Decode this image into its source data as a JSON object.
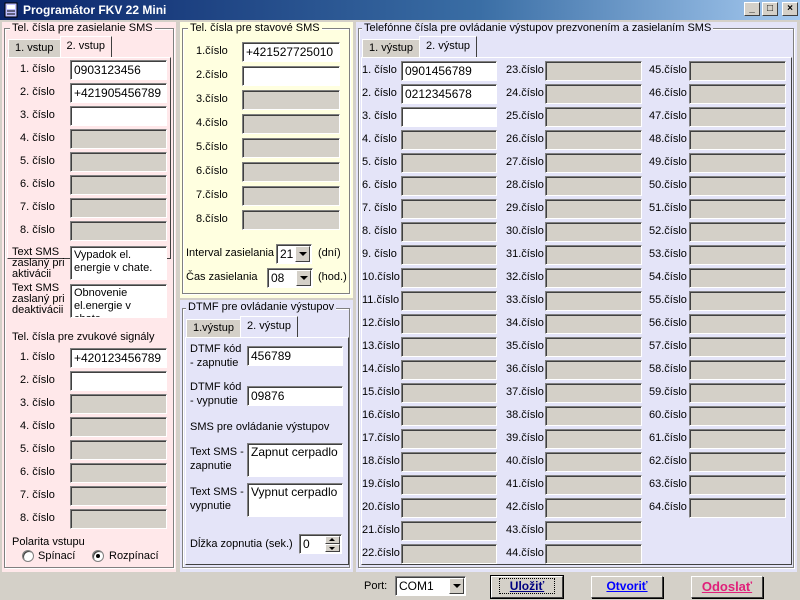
{
  "window": {
    "title": "Programátor FKV 22 Mini"
  },
  "sms_panel": {
    "title": "Tel. čísla pre zasielanie SMS",
    "tabs": [
      "1. vstup",
      "2. vstup"
    ],
    "active_tab": 1,
    "numbers": [
      {
        "label": "1. číslo",
        "value": "0903123456",
        "enabled": true
      },
      {
        "label": "2. číslo",
        "value": "+421905456789",
        "enabled": true
      },
      {
        "label": "3. číslo",
        "value": "",
        "enabled": true
      },
      {
        "label": "4. číslo",
        "value": "",
        "enabled": false
      },
      {
        "label": "5. číslo",
        "value": "",
        "enabled": false
      },
      {
        "label": "6. číslo",
        "value": "",
        "enabled": false
      },
      {
        "label": "7. číslo",
        "value": "",
        "enabled": false
      },
      {
        "label": "8. číslo",
        "value": "",
        "enabled": false
      }
    ],
    "activation": {
      "label": "Text SMS zaslaný pri aktivácii",
      "value": "Vypadok el. energie v chate."
    },
    "deactivation": {
      "label": "Text SMS zaslaný pri deaktivácii",
      "value": "Obnovenie el.energie v chate."
    },
    "sound_title": "Tel. čísla pre zvukové signály",
    "sound_numbers": [
      {
        "label": "1. číslo",
        "value": "+420123456789",
        "enabled": true
      },
      {
        "label": "2. číslo",
        "value": "",
        "enabled": true
      },
      {
        "label": "3. číslo",
        "value": "",
        "enabled": false
      },
      {
        "label": "4. číslo",
        "value": "",
        "enabled": false
      },
      {
        "label": "5. číslo",
        "value": "",
        "enabled": false
      },
      {
        "label": "6. číslo",
        "value": "",
        "enabled": false
      },
      {
        "label": "7. číslo",
        "value": "",
        "enabled": false
      },
      {
        "label": "8. číslo",
        "value": "",
        "enabled": false
      }
    ],
    "polarity_label": "Polarita vstupu",
    "polarity_options": [
      "Spínací",
      "Rozpínací"
    ],
    "polarity_selected": 1
  },
  "status_panel": {
    "title": "Tel. čísla pre stavové SMS",
    "numbers": [
      {
        "label": "1.číslo",
        "value": "+421527725010",
        "enabled": true
      },
      {
        "label": "2.číslo",
        "value": "",
        "enabled": true
      },
      {
        "label": "3.číslo",
        "value": "",
        "enabled": false
      },
      {
        "label": "4.číslo",
        "value": "",
        "enabled": false
      },
      {
        "label": "5.číslo",
        "value": "",
        "enabled": false
      },
      {
        "label": "6.číslo",
        "value": "",
        "enabled": false
      },
      {
        "label": "7.číslo",
        "value": "",
        "enabled": false
      },
      {
        "label": "8.číslo",
        "value": "",
        "enabled": false
      }
    ],
    "interval_label": "Interval zasielania",
    "interval_value": "21",
    "interval_unit": "(dní)",
    "time_label": "Čas zasielania",
    "time_value": "08",
    "time_unit": "(hod.)"
  },
  "dtmf_panel": {
    "title": "DTMF pre ovládanie výstupov",
    "tabs": [
      "1.výstup",
      "2. výstup"
    ],
    "active_tab": 1,
    "code_on_label": "DTMF kód - zapnutie",
    "code_on_value": "456789",
    "code_off_label": "DTMF kód - vypnutie",
    "code_off_value": "09876",
    "sms_title": "SMS pre ovládanie výstupov",
    "sms_on_label": "Text SMS - zapnutie",
    "sms_on_value": "Zapnut cerpadlo",
    "sms_off_label": "Text SMS - vypnutie",
    "sms_off_value": "Vypnut cerpadlo",
    "duration_label": "Dĺžka zopnutia (sek.)",
    "duration_value": "0"
  },
  "output_panel": {
    "title": "Telefónne čísla pre ovládanie výstupov prezvonením a zasielaním SMS",
    "tabs": [
      "1. výstup",
      "2. výstup"
    ],
    "active_tab": 1,
    "col1": [
      {
        "label": "1. číslo",
        "value": "0901456789",
        "enabled": true
      },
      {
        "label": "2. číslo",
        "value": "0212345678",
        "enabled": true
      },
      {
        "label": "3. číslo",
        "value": "",
        "enabled": true
      },
      {
        "label": "4. číslo",
        "value": "",
        "enabled": false
      },
      {
        "label": "5. číslo",
        "value": "",
        "enabled": false
      },
      {
        "label": "6. číslo",
        "value": "",
        "enabled": false
      },
      {
        "label": "7. číslo",
        "value": "",
        "enabled": false
      },
      {
        "label": "8. číslo",
        "value": "",
        "enabled": false
      },
      {
        "label": "9. číslo",
        "value": "",
        "enabled": false
      },
      {
        "label": "10.číslo",
        "value": "",
        "enabled": false
      },
      {
        "label": "11.číslo",
        "value": "",
        "enabled": false
      },
      {
        "label": "12.číslo",
        "value": "",
        "enabled": false
      },
      {
        "label": "13.číslo",
        "value": "",
        "enabled": false
      },
      {
        "label": "14.číslo",
        "value": "",
        "enabled": false
      },
      {
        "label": "15.číslo",
        "value": "",
        "enabled": false
      },
      {
        "label": "16.číslo",
        "value": "",
        "enabled": false
      },
      {
        "label": "17.číslo",
        "value": "",
        "enabled": false
      },
      {
        "label": "18.číslo",
        "value": "",
        "enabled": false
      },
      {
        "label": "19.číslo",
        "value": "",
        "enabled": false
      },
      {
        "label": "20.číslo",
        "value": "",
        "enabled": false
      },
      {
        "label": "21.číslo",
        "value": "",
        "enabled": false
      },
      {
        "label": "22.číslo",
        "value": "",
        "enabled": false
      }
    ],
    "col2": [
      {
        "label": "23.číslo"
      },
      {
        "label": "24.číslo"
      },
      {
        "label": "25.číslo"
      },
      {
        "label": "26.číslo"
      },
      {
        "label": "27.číslo"
      },
      {
        "label": "28.číslo"
      },
      {
        "label": "29.číslo"
      },
      {
        "label": "30.číslo"
      },
      {
        "label": "31.číslo"
      },
      {
        "label": "32.číslo"
      },
      {
        "label": "33.číslo"
      },
      {
        "label": "34.číslo"
      },
      {
        "label": "35.číslo"
      },
      {
        "label": "36.číslo"
      },
      {
        "label": "37.číslo"
      },
      {
        "label": "38.číslo"
      },
      {
        "label": "39.číslo"
      },
      {
        "label": "40.číslo"
      },
      {
        "label": "41.číslo"
      },
      {
        "label": "42.číslo"
      },
      {
        "label": "43.číslo"
      },
      {
        "label": "44.číslo"
      }
    ],
    "col3": [
      {
        "label": "45.číslo"
      },
      {
        "label": "46.číslo"
      },
      {
        "label": "47.číslo"
      },
      {
        "label": "48.číslo"
      },
      {
        "label": "49.číslo"
      },
      {
        "label": "50.číslo"
      },
      {
        "label": "51.číslo"
      },
      {
        "label": "52.číslo"
      },
      {
        "label": "53.číslo"
      },
      {
        "label": "54.číslo"
      },
      {
        "label": "55.číslo"
      },
      {
        "label": "56.číslo"
      },
      {
        "label": "57.číslo"
      },
      {
        "label": "58.číslo"
      },
      {
        "label": "59.číslo"
      },
      {
        "label": "60.číslo"
      },
      {
        "label": "61.číslo"
      },
      {
        "label": "62.číslo"
      },
      {
        "label": "63.číslo"
      },
      {
        "label": "64.číslo"
      }
    ]
  },
  "bottom": {
    "port_label": "Port:",
    "port_value": "COM1",
    "save_label": "Uložiť",
    "open_label": "Otvoriť",
    "send_label": "Odoslať",
    "save_color": "#000080",
    "open_color": "#0000ff",
    "send_color": "#e0207a"
  },
  "colors": {
    "sms_bg": "#ffe8ea",
    "status_bg": "#ffffe0",
    "dtmf_bg": "#e4e4f8",
    "output_bg": "#e4e4f8"
  }
}
